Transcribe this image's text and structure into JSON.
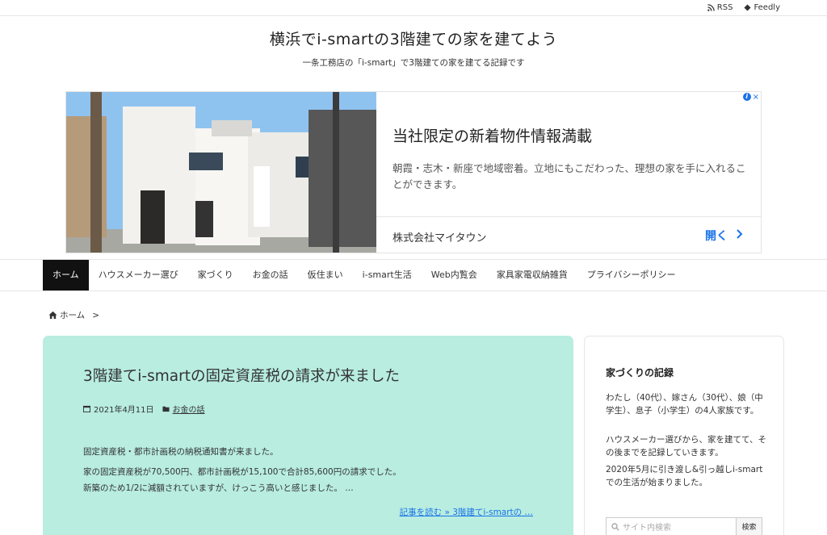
{
  "topbar": {
    "rss_label": "RSS",
    "feedly_label": "Feedly"
  },
  "header": {
    "title": "横浜でi-smartの3階建ての家を建てよう",
    "description": "一条工務店の「i-smart」で3階建ての家を建てる記録です"
  },
  "ad": {
    "title": "当社限定の新着物件情報満載",
    "description": "朝霞・志木・新座で地域密着。立地にもこだわった、理想の家を手に入れることができます。",
    "company": "株式会社マイタウン",
    "open_label": "開く",
    "choice_icon": "i",
    "close_icon": "×"
  },
  "nav": {
    "items": [
      {
        "label": "ホーム"
      },
      {
        "label": "ハウスメーカー選び"
      },
      {
        "label": "家づくり"
      },
      {
        "label": "お金の話"
      },
      {
        "label": "仮住まい"
      },
      {
        "label": "i-smart生活"
      },
      {
        "label": "Web内覧会"
      },
      {
        "label": "家具家電収納雑貨"
      },
      {
        "label": "プライバシーポリシー"
      }
    ]
  },
  "breadcrumb": {
    "home_label": "ホーム",
    "separator": ">"
  },
  "article": {
    "title": "3階建てi-smartの固定資産税の請求が来ました",
    "date": "2021年4月11日",
    "category": "お金の話",
    "paragraphs": [
      "固定資産税・都市計画税の納税通知書が来ました。",
      "家の固定資産税が70,500円、都市計画税が15,100で合計85,600円の請求でした。",
      "新築のため1/2に減額されていますが、けっこう高いと感じました。 …"
    ],
    "read_more": "記事を読む »  3階建てi-smartの …"
  },
  "sidebar": {
    "title": "家づくりの記録",
    "paragraphs": [
      "わたし（40代）、嫁さん（30代）、娘（中学生）、息子（小学生）の4人家族です。",
      "ハウスメーカー選びから、家を建てて、その後までを記録していきます。",
      "2020年5月に引き渡し&引っ越しi-smartでの生活が始まりました。"
    ],
    "search_placeholder": "サイト内検索",
    "search_button": "検索"
  }
}
